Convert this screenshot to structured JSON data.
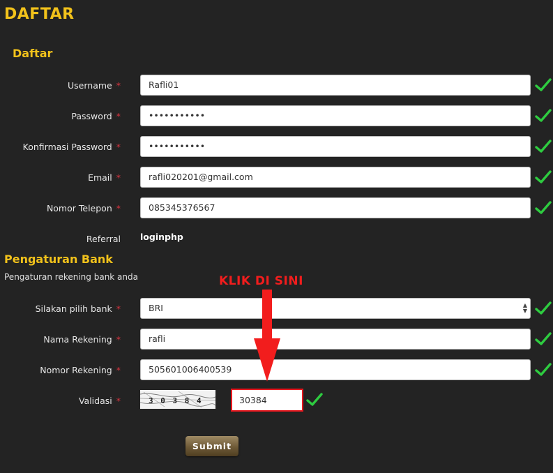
{
  "page": {
    "title": "DAFTAR"
  },
  "form": {
    "section_title": "Daftar",
    "required_mark": "*",
    "username": {
      "label": "Username",
      "value": "Rafli01"
    },
    "password": {
      "label": "Password",
      "value": "•••••••••••"
    },
    "confirm_password": {
      "label": "Konfirmasi Password",
      "value": "•••••••••••"
    },
    "email": {
      "label": "Email",
      "value": "rafli020201@gmail.com"
    },
    "phone": {
      "label": "Nomor Telepon",
      "value": "085345376567"
    },
    "referral": {
      "label": "Referral",
      "value": "loginphp"
    }
  },
  "bank": {
    "section_title": "Pengaturan Bank",
    "description": "Pengaturan rekening bank anda",
    "bank_select": {
      "label": "Silakan pilih bank",
      "value": "BRI"
    },
    "account_name": {
      "label": "Nama Rekening",
      "value": "rafli"
    },
    "account_number": {
      "label": "Nomor Rekening",
      "value": "505601006400539"
    }
  },
  "validation": {
    "label": "Validasi",
    "captcha_text": "3 0 3 8 4",
    "value": "30384"
  },
  "annotation": {
    "text": "KLIK DI SINI"
  },
  "submit": {
    "label": "Submit"
  },
  "colors": {
    "accent": "#f2c21b",
    "check": "#2ecc40",
    "annotation": "#f21d1d"
  }
}
